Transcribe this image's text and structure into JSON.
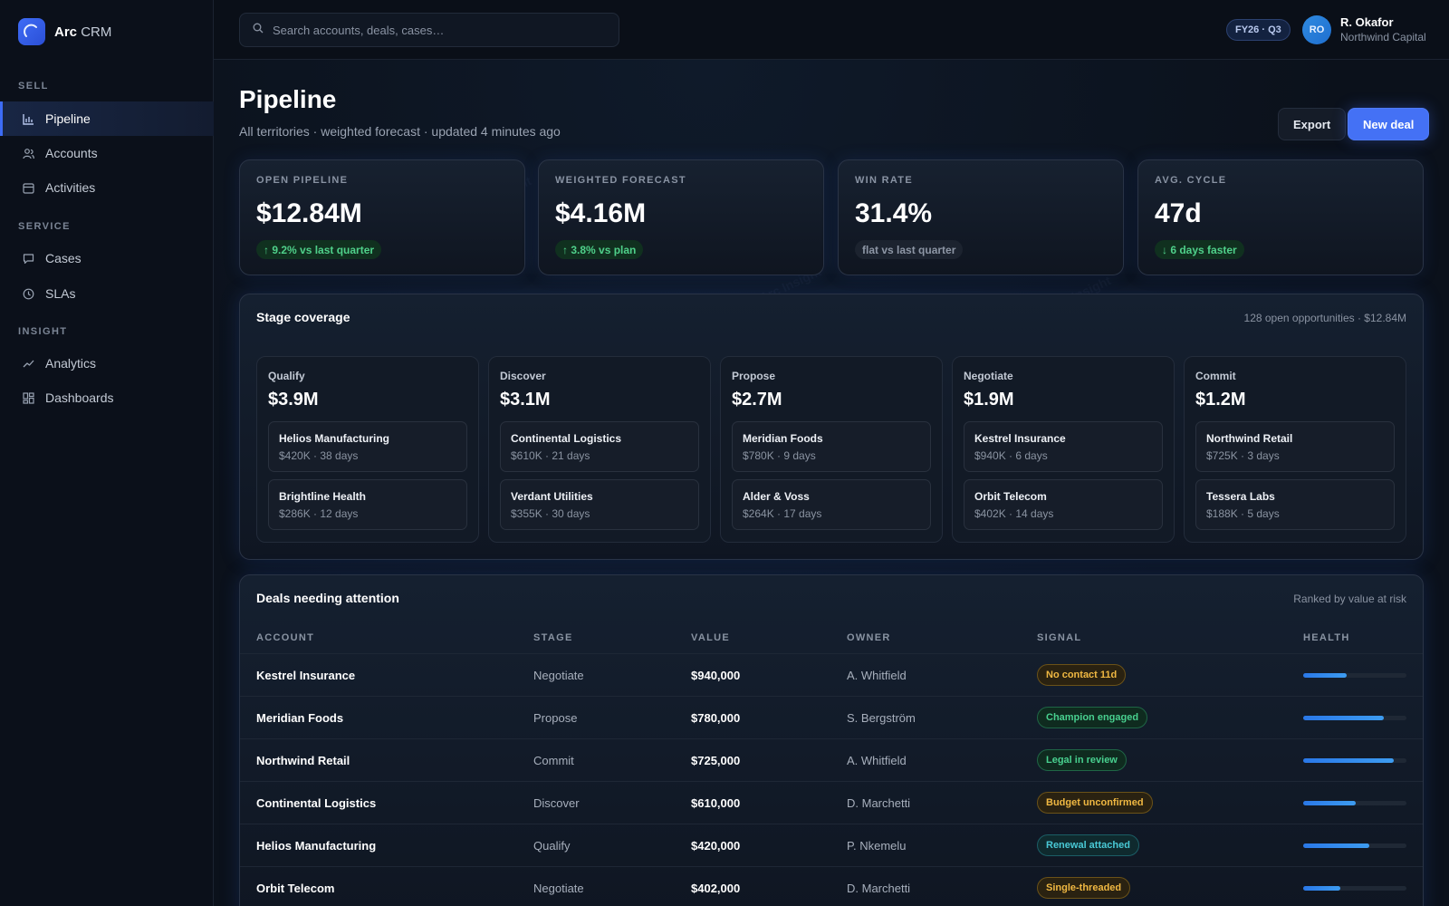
{
  "app": {
    "brand_bold": "Arc",
    "brand_light": "CRM"
  },
  "sidebar": {
    "sections": [
      {
        "label": "SELL",
        "items": [
          {
            "label": "Pipeline",
            "icon": "bar-chart-icon",
            "active": true
          },
          {
            "label": "Accounts",
            "icon": "users-icon"
          },
          {
            "label": "Activities",
            "icon": "calendar-icon"
          }
        ]
      },
      {
        "label": "SERVICE",
        "items": [
          {
            "label": "Cases",
            "icon": "message-icon"
          },
          {
            "label": "SLAs",
            "icon": "clock-icon"
          }
        ]
      },
      {
        "label": "INSIGHT",
        "items": [
          {
            "label": "Analytics",
            "icon": "trend-line-icon"
          },
          {
            "label": "Dashboards",
            "icon": "grid-icon"
          }
        ]
      }
    ]
  },
  "topbar": {
    "search_placeholder": "Search accounts, deals, cases…",
    "period": "FY26 · Q3",
    "user": {
      "initials": "RO",
      "name": "R. Okafor",
      "org": "Northwind Capital"
    }
  },
  "page": {
    "title": "Pipeline",
    "subtitle": "All territories · weighted forecast · updated 4 minutes ago",
    "export_label": "Export",
    "new_deal_label": "New deal"
  },
  "kpis": [
    {
      "label": "OPEN PIPELINE",
      "value": "$12.84M",
      "delta": "9.2% vs last quarter",
      "trend": "up"
    },
    {
      "label": "WEIGHTED FORECAST",
      "value": "$4.16M",
      "delta": "3.8% vs plan",
      "trend": "up"
    },
    {
      "label": "WIN RATE",
      "value": "31.4%",
      "delta": "flat vs last quarter",
      "trend": "flat"
    },
    {
      "label": "AVG. CYCLE",
      "value": "47d",
      "delta": "6 days faster",
      "trend": "down-good"
    }
  ],
  "stage_coverage": {
    "title": "Stage coverage",
    "meta": "128 open opportunities · $12.84M",
    "stages": [
      {
        "name": "Qualify",
        "total": "$3.9M",
        "deals": [
          {
            "name": "Helios Manufacturing",
            "meta": "$420K · 38 days"
          },
          {
            "name": "Brightline Health",
            "meta": "$286K · 12 days"
          }
        ]
      },
      {
        "name": "Discover",
        "total": "$3.1M",
        "deals": [
          {
            "name": "Continental Logistics",
            "meta": "$610K · 21 days"
          },
          {
            "name": "Verdant Utilities",
            "meta": "$355K · 30 days"
          }
        ]
      },
      {
        "name": "Propose",
        "total": "$2.7M",
        "deals": [
          {
            "name": "Meridian Foods",
            "meta": "$780K · 9 days"
          },
          {
            "name": "Alder & Voss",
            "meta": "$264K · 17 days"
          }
        ]
      },
      {
        "name": "Negotiate",
        "total": "$1.9M",
        "deals": [
          {
            "name": "Kestrel Insurance",
            "meta": "$940K · 6 days"
          },
          {
            "name": "Orbit Telecom",
            "meta": "$402K · 14 days"
          }
        ]
      },
      {
        "name": "Commit",
        "total": "$1.2M",
        "deals": [
          {
            "name": "Northwind Retail",
            "meta": "$725K · 3 days"
          },
          {
            "name": "Tessera Labs",
            "meta": "$188K · 5 days"
          }
        ]
      }
    ]
  },
  "attention": {
    "title": "Deals needing attention",
    "meta": "Ranked by value at risk",
    "columns": [
      "ACCOUNT",
      "STAGE",
      "VALUE",
      "OWNER",
      "SIGNAL",
      "HEALTH"
    ],
    "rows": [
      {
        "account": "Kestrel Insurance",
        "stage": "Negotiate",
        "value": "$940,000",
        "owner": "A. Whitfield",
        "signal": "No contact 11d",
        "signal_type": "warn",
        "health": 0.42
      },
      {
        "account": "Meridian Foods",
        "stage": "Propose",
        "value": "$780,000",
        "owner": "S. Bergström",
        "signal": "Champion engaged",
        "signal_type": "good",
        "health": 0.78
      },
      {
        "account": "Northwind Retail",
        "stage": "Commit",
        "value": "$725,000",
        "owner": "A. Whitfield",
        "signal": "Legal in review",
        "signal_type": "good",
        "health": 0.88
      },
      {
        "account": "Continental Logistics",
        "stage": "Discover",
        "value": "$610,000",
        "owner": "D. Marchetti",
        "signal": "Budget unconfirmed",
        "signal_type": "warn",
        "health": 0.51
      },
      {
        "account": "Helios Manufacturing",
        "stage": "Qualify",
        "value": "$420,000",
        "owner": "P. Nkemelu",
        "signal": "Renewal attached",
        "signal_type": "info",
        "health": 0.64
      },
      {
        "account": "Orbit Telecom",
        "stage": "Negotiate",
        "value": "$402,000",
        "owner": "D. Marchetti",
        "signal": "Single-threaded",
        "signal_type": "warn",
        "health": 0.36
      }
    ]
  },
  "colors": {
    "accent": "#4471f5",
    "good": "#4fd08a",
    "warn": "#f0b842",
    "info": "#49c9d6"
  }
}
